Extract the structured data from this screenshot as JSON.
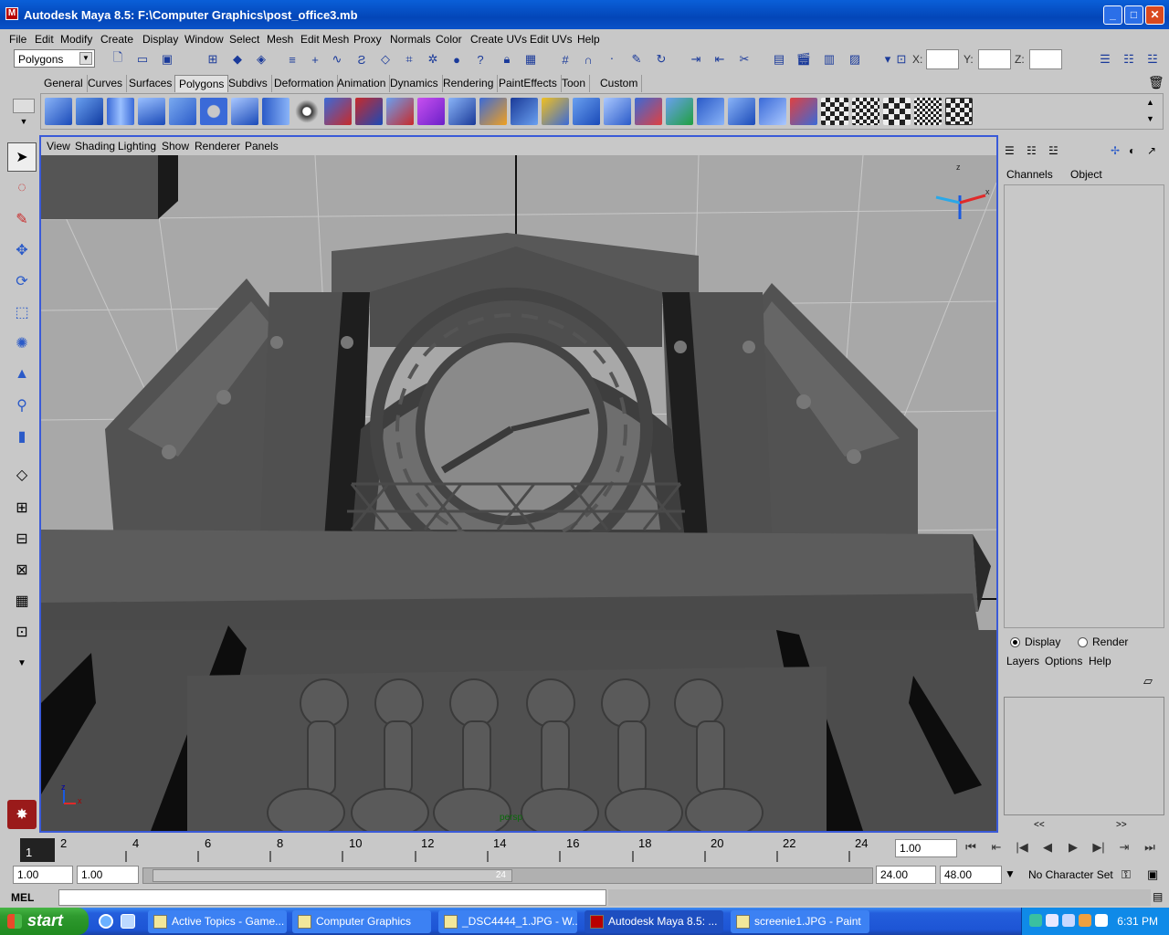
{
  "window": {
    "title": "Autodesk Maya 8.5: F:\\Computer Graphics\\post_office3.mb",
    "minimize": "_",
    "maximize": "□",
    "close": "✕"
  },
  "menubar": [
    "File",
    "Edit",
    "Modify",
    "Create",
    "Display",
    "Window",
    "Select",
    "Mesh",
    "Edit Mesh",
    "Proxy",
    "Normals",
    "Color",
    "Create UVs",
    "Edit UVs",
    "Help"
  ],
  "statusline": {
    "menuset": "Polygons",
    "x_label": "X:",
    "y_label": "Y:",
    "z_label": "Z:",
    "x_value": "",
    "y_value": "",
    "z_value": ""
  },
  "shelf_tabs": [
    "General",
    "Curves",
    "Surfaces",
    "Polygons",
    "Subdivs",
    "Deformation",
    "Animation",
    "Dynamics",
    "Rendering",
    "PaintEffects",
    "Toon",
    "Custom"
  ],
  "shelf_active_tab": "Polygons",
  "viewport": {
    "menu": [
      "View",
      "Shading",
      "Lighting",
      "Show",
      "Renderer",
      "Panels"
    ],
    "camera_label": "persp",
    "axis_x": "x",
    "axis_z": "z"
  },
  "channelbox": {
    "tabs": [
      "Channels",
      "Object"
    ],
    "display_label": "Display",
    "render_label": "Render",
    "layer_menu": [
      "Layers",
      "Options",
      "Help"
    ],
    "display_selected": true,
    "scroll_left": "<<",
    "scroll_right": ">>"
  },
  "timeslider": {
    "current_frame": "1",
    "tick_labels": [
      "2",
      "4",
      "6",
      "8",
      "10",
      "12",
      "14",
      "16",
      "18",
      "20",
      "22",
      "24"
    ],
    "current_time": "1.00"
  },
  "rangeslider": {
    "start": "1.00",
    "start_inner": "1.00",
    "end_inner": "24.00",
    "end": "48.00",
    "handle_label": "24",
    "character_set": "No Character Set"
  },
  "mel": {
    "label": "MEL",
    "command": ""
  },
  "taskbar": {
    "start": "start",
    "items": [
      {
        "label": "Active Topics - Game...",
        "active": false
      },
      {
        "label": "Computer Graphics",
        "active": false
      },
      {
        "label": "_DSC4444_1.JPG - W...",
        "active": false
      },
      {
        "label": "Autodesk Maya 8.5: ...",
        "active": true
      },
      {
        "label": "screenie1.JPG - Paint",
        "active": false
      }
    ],
    "clock": "6:31 PM"
  },
  "colors": {
    "title_bar": "#0a5fd8",
    "viewport_border": "#3a5ad8",
    "scene_gray": "#5a5a5a",
    "taskbar": "#245edc",
    "start_green": "#2f9a2f"
  }
}
